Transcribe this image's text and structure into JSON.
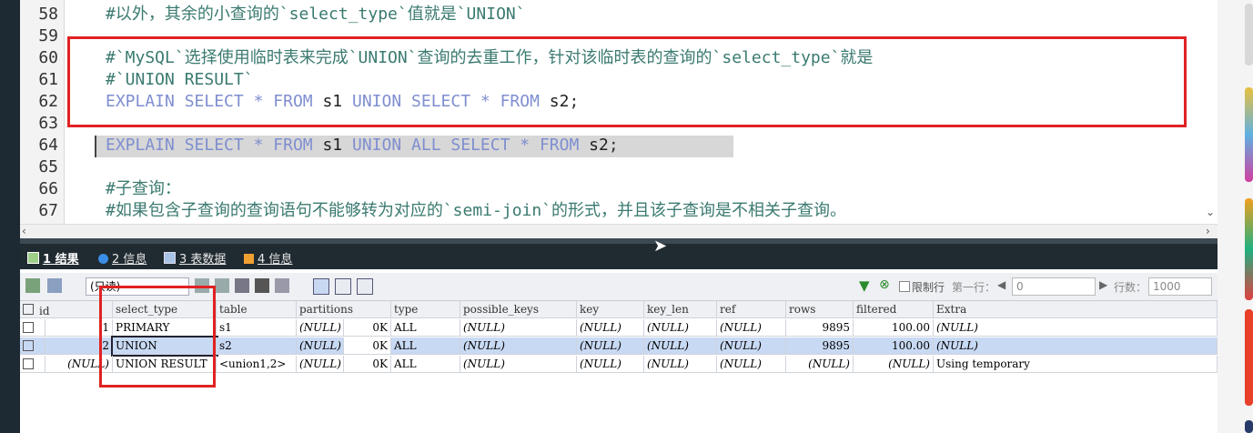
{
  "editor": {
    "lines": [
      {
        "num": "58",
        "type": "comment",
        "text": "#以外，其余的小查询的`select_type`值就是`UNION`"
      },
      {
        "num": "59",
        "type": "blank",
        "text": ""
      },
      {
        "num": "60",
        "type": "comment",
        "text": "#`MySQL`选择使用临时表来完成`UNION`查询的去重工作，针对该临时表的查询的`select_type`就是"
      },
      {
        "num": "61",
        "type": "comment",
        "text": "#`UNION RESULT`"
      },
      {
        "num": "62",
        "type": "sql",
        "tokens": [
          "EXPLAIN",
          "SELECT",
          "*",
          "FROM",
          "s1",
          "UNION",
          "SELECT",
          "*",
          "FROM",
          "s2",
          ";"
        ]
      },
      {
        "num": "63",
        "type": "blank",
        "text": ""
      },
      {
        "num": "64",
        "type": "sql",
        "tokens": [
          "EXPLAIN",
          "SELECT",
          "*",
          "FROM",
          "s1",
          "UNION",
          "ALL",
          "SELECT",
          "*",
          "FROM",
          "s2",
          ";"
        ]
      },
      {
        "num": "65",
        "type": "blank",
        "text": ""
      },
      {
        "num": "66",
        "type": "comment",
        "text": "#子查询："
      },
      {
        "num": "67",
        "type": "comment",
        "text": "#如果包含子查询的查询语句不能够转为对应的`semi-join`的形式，并且该子查询是不相关子查询。"
      }
    ]
  },
  "tabs": [
    {
      "num": "1",
      "label": "结果",
      "active": true,
      "icon": "grid-icon"
    },
    {
      "num": "2",
      "label": "信息",
      "active": false,
      "icon": "info-icon"
    },
    {
      "num": "3",
      "label": "表数据",
      "active": false,
      "icon": "table-icon"
    },
    {
      "num": "4",
      "label": "信息",
      "active": false,
      "icon": "chart-icon"
    }
  ],
  "toolbar": {
    "mode_select": "(只读)",
    "limit_label": "限制行",
    "first_row_label": "第一行：",
    "first_row_value": "0",
    "row_count_label": "行数：",
    "row_count_value": "1000"
  },
  "grid": {
    "columns": [
      "id",
      "select_type",
      "table",
      "partitions",
      "type",
      "possible_keys",
      "key",
      "key_len",
      "ref",
      "rows",
      "filtered",
      "Extra"
    ],
    "rows": [
      {
        "id": "1",
        "select_type": "PRIMARY",
        "table": "s1",
        "partitions": "(NULL)",
        "ok": "0K",
        "type": "ALL",
        "possible_keys": "(NULL)",
        "key": "(NULL)",
        "key_len": "(NULL)",
        "ref": "(NULL)",
        "rows": "9895",
        "filtered": "100.00",
        "Extra": "(NULL)"
      },
      {
        "id": "2",
        "select_type": "UNION",
        "table": "s2",
        "partitions": "(NULL)",
        "ok": "0K",
        "type": "ALL",
        "possible_keys": "(NULL)",
        "key": "(NULL)",
        "key_len": "(NULL)",
        "ref": "(NULL)",
        "rows": "9895",
        "filtered": "100.00",
        "Extra": "(NULL)"
      },
      {
        "id": "(NULL)",
        "select_type": "UNION RESULT",
        "table": "<union1,2>",
        "partitions": "(NULL)",
        "ok": "0K",
        "type": "ALL",
        "possible_keys": "(NULL)",
        "key": "(NULL)",
        "key_len": "(NULL)",
        "ref": "(NULL)",
        "rows": "(NULL)",
        "filtered": "(NULL)",
        "Extra": "Using temporary"
      }
    ]
  },
  "colors": {
    "comment": "#3a7a70",
    "keyword": "#7f8ed0",
    "annotation_box": "#e02222",
    "selected_row": "#c8d9f3"
  }
}
